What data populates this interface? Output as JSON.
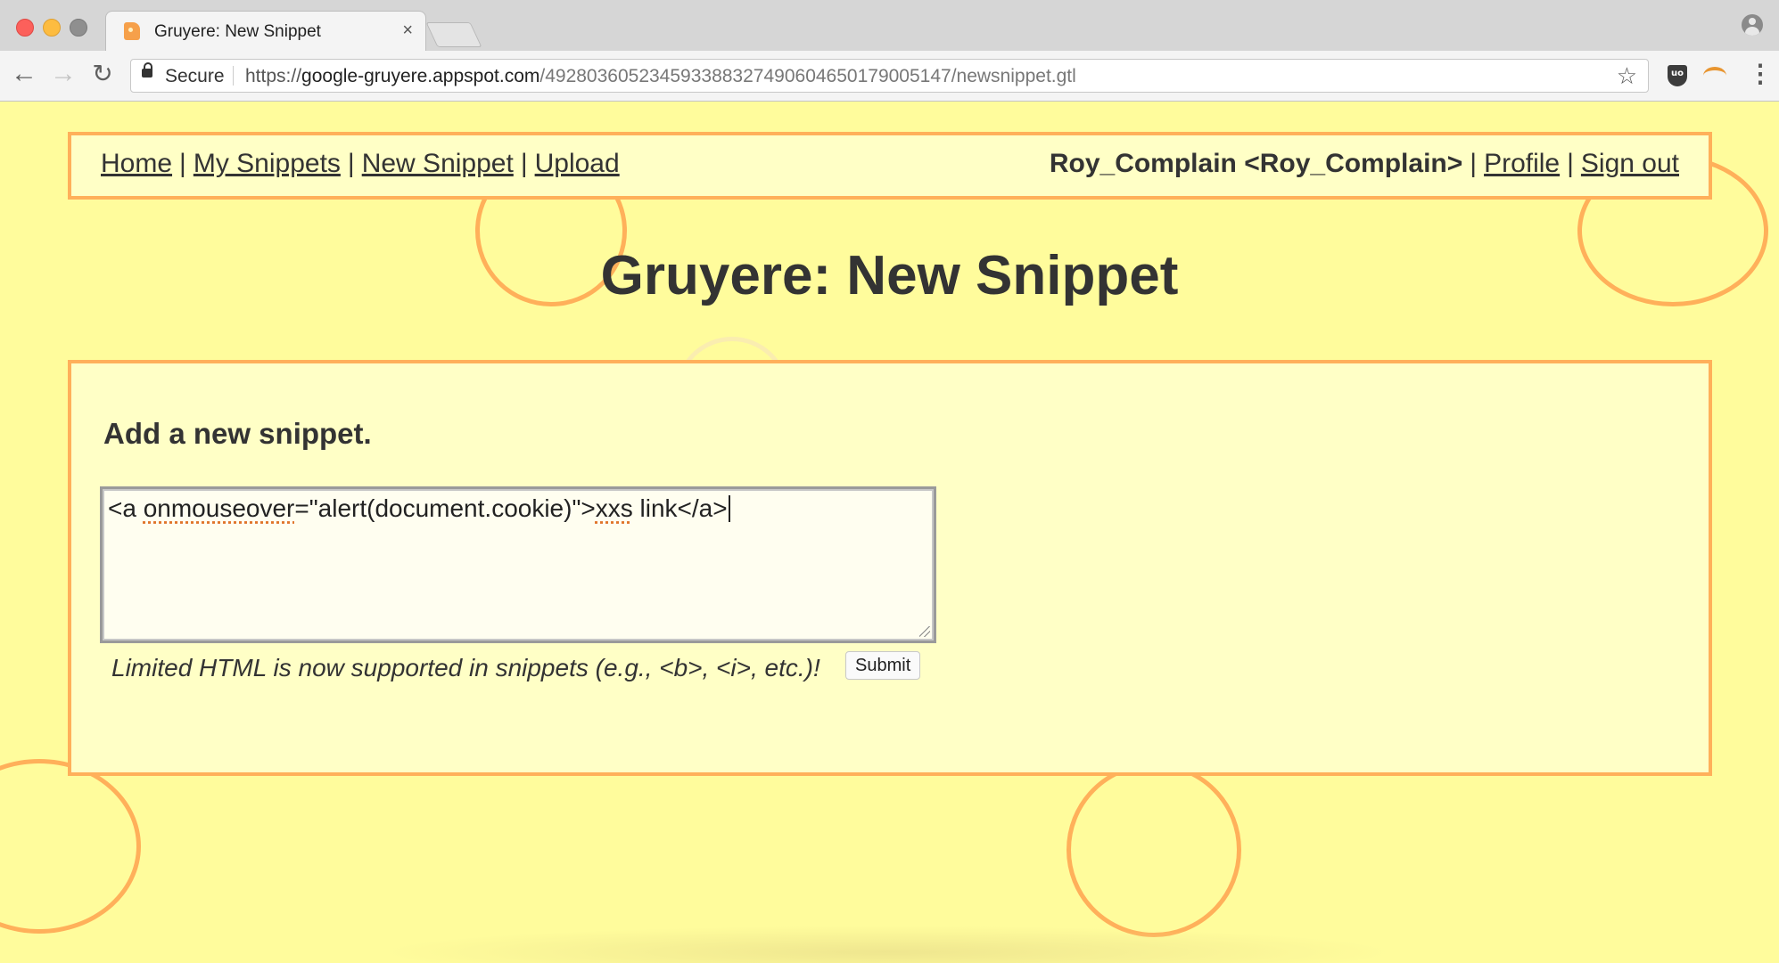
{
  "browser": {
    "tab": {
      "title": "Gruyere: New Snippet",
      "close": "×"
    },
    "nav": {
      "back": "←",
      "forward": "→",
      "reload": "↻"
    },
    "address": {
      "secure_label": "Secure",
      "url_scheme": "https://",
      "url_host": "google-gruyere.appspot.com",
      "url_path": "/492803605234593388327490604650179005147/newsnippet.gtl",
      "bookmark": "☆"
    },
    "menu": "⋮"
  },
  "header_nav": {
    "links": [
      {
        "label": "Home"
      },
      {
        "label": "My Snippets"
      },
      {
        "label": "New Snippet"
      },
      {
        "label": "Upload"
      }
    ],
    "separator": "|",
    "user": "Roy_Complain <Roy_Complain>",
    "right_links": [
      {
        "label": "Profile"
      },
      {
        "label": "Sign out"
      }
    ]
  },
  "page": {
    "title": "Gruyere: New Snippet"
  },
  "form": {
    "heading": "Add a new snippet.",
    "textarea": {
      "value_part1": "<a ",
      "value_spell1": "onmouseover",
      "value_part2": "=\"alert(document.cookie)\">",
      "value_spell2": "xxs",
      "value_part3": " link</a>"
    },
    "hint": "Limited HTML is now supported in snippets (e.g., <b>, <i>, etc.)!",
    "submit_label": "Submit"
  },
  "colors": {
    "page_background": "#fffc9c",
    "box_background": "#ffffc6",
    "accent_orange": "#ffb05a",
    "text": "#333333"
  }
}
